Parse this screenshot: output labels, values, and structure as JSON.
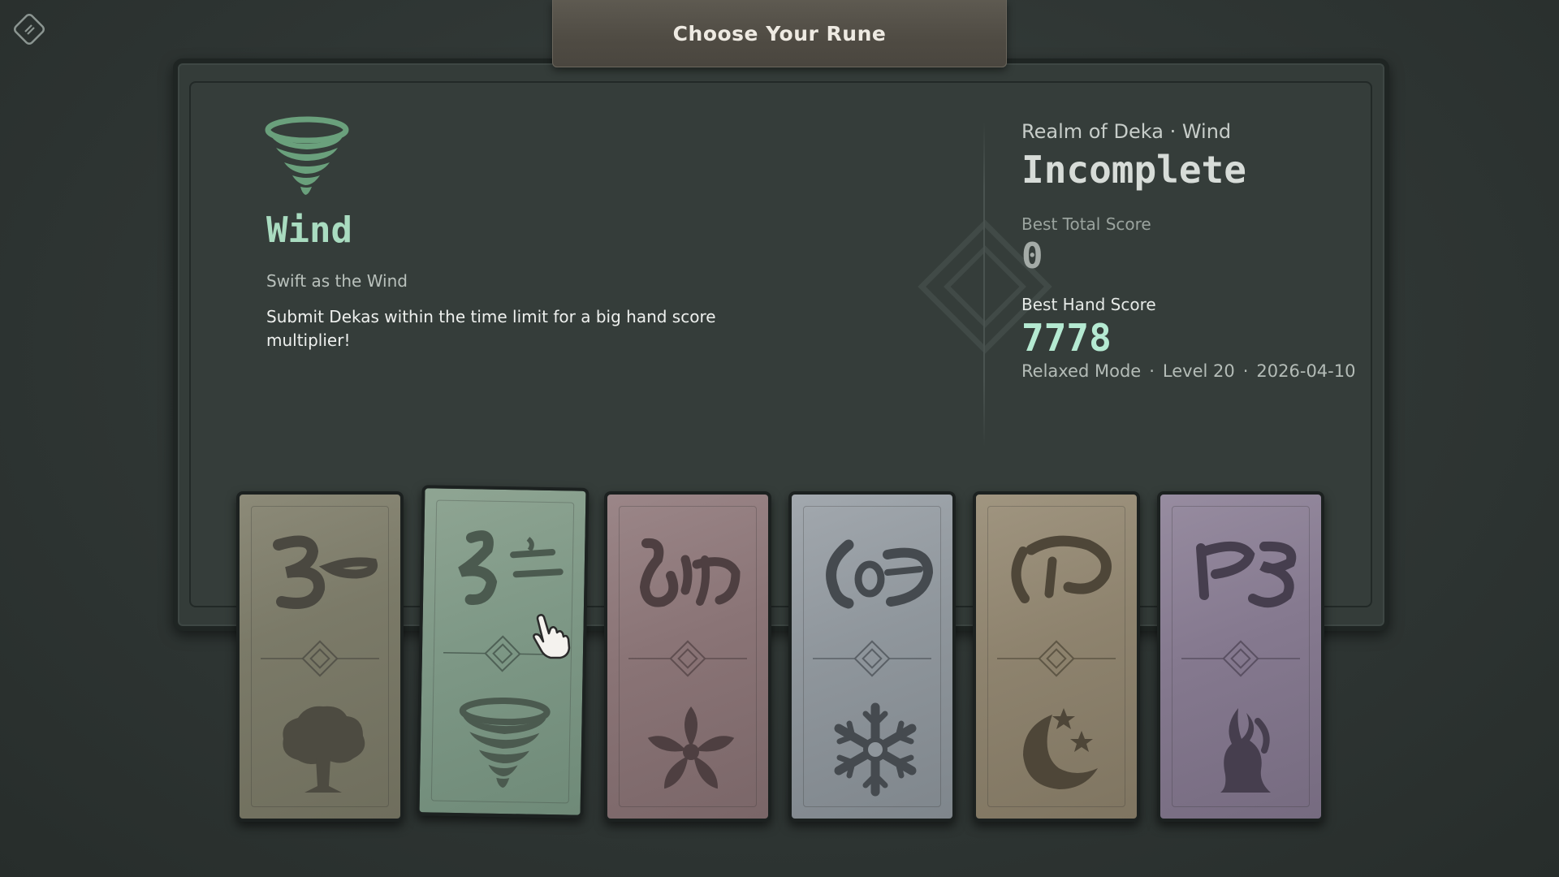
{
  "header": {
    "title": "Choose Your Rune"
  },
  "menu": {
    "icon": "menu-diamond-icon"
  },
  "rune": {
    "icon": "tornado-icon",
    "name": "Wind",
    "tagline": "Swift as the Wind",
    "description": "Submit Dekas within the time limit for a big hand score multiplier!"
  },
  "stats": {
    "realm": "Realm of Deka · Wind",
    "status": "Incomplete",
    "best_total_label": "Best Total Score",
    "best_total_value": "0",
    "best_hand_label": "Best Hand Score",
    "best_hand_value": "7778",
    "mode": "Relaxed Mode",
    "level": "Level 20",
    "date": "2026-04-10"
  },
  "cards": [
    {
      "id": "tree",
      "symbol": "tree-icon",
      "color": "#7b7a68",
      "selected": false
    },
    {
      "id": "wind",
      "symbol": "tornado-icon",
      "color": "#7e9886",
      "selected": true
    },
    {
      "id": "bloom",
      "symbol": "flower-icon",
      "color": "#8a7476",
      "selected": false
    },
    {
      "id": "frost",
      "symbol": "snowflake-icon",
      "color": "#8f969c",
      "selected": false
    },
    {
      "id": "moon",
      "symbol": "moon-star-icon",
      "color": "#8e836e",
      "selected": false
    },
    {
      "id": "flame",
      "symbol": "flame-icon",
      "color": "#85798f",
      "selected": false
    }
  ],
  "colors": {
    "accent": "#a9dcc0",
    "hand_score": "#b5ead2",
    "background": "#2f3634"
  }
}
